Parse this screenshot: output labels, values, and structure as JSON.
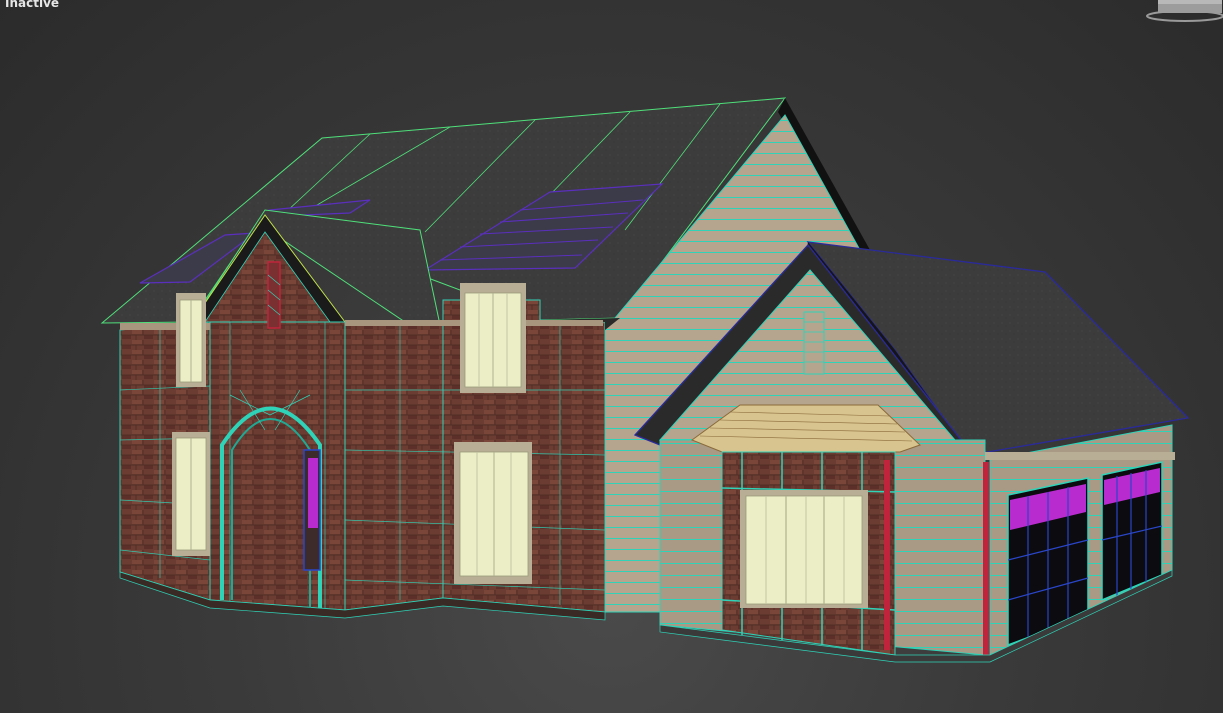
{
  "viewport": {
    "label": "Inactive"
  },
  "colors": {
    "background": "#353535",
    "roof": "#3b3b3b",
    "brick": "#6a3a30",
    "siding": "#b6a58f",
    "window_glass": "#ecefc6",
    "wire_cyan": "#2fd3b8",
    "wire_green": "#4fe07a",
    "wire_purple": "#5a2fbd",
    "wire_blue": "#2a2a9a",
    "garage_accent": "#b82bcf",
    "trim_red": "#c0243c"
  },
  "icons": {
    "viewcube": "viewcube-icon"
  }
}
